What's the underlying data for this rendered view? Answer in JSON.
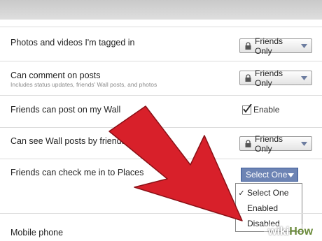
{
  "rows": [
    {
      "label": "Photos and videos I'm tagged in",
      "control": "Friends Only"
    },
    {
      "label": "Can comment on posts",
      "sublabel": "Includes status updates, friends' Wall posts, and photos",
      "control": "Friends Only"
    },
    {
      "label": "Friends can post on my Wall",
      "checkbox_label": "Enable",
      "checked": true
    },
    {
      "label": "Can see Wall posts by friends",
      "control": "Friends Only"
    },
    {
      "label": "Friends can check me in to Places",
      "select_value": "Select One"
    }
  ],
  "dropdown": {
    "options": [
      {
        "label": "Select One",
        "selected": true
      },
      {
        "label": "Enabled",
        "selected": false
      },
      {
        "label": "Disabled",
        "selected": false
      }
    ]
  },
  "next_row_label": "Mobile phone",
  "watermark": {
    "part1": "wiki",
    "part2": "How"
  },
  "colors": {
    "select_bg": "#6d84b4",
    "arrow": "#d8202a"
  }
}
